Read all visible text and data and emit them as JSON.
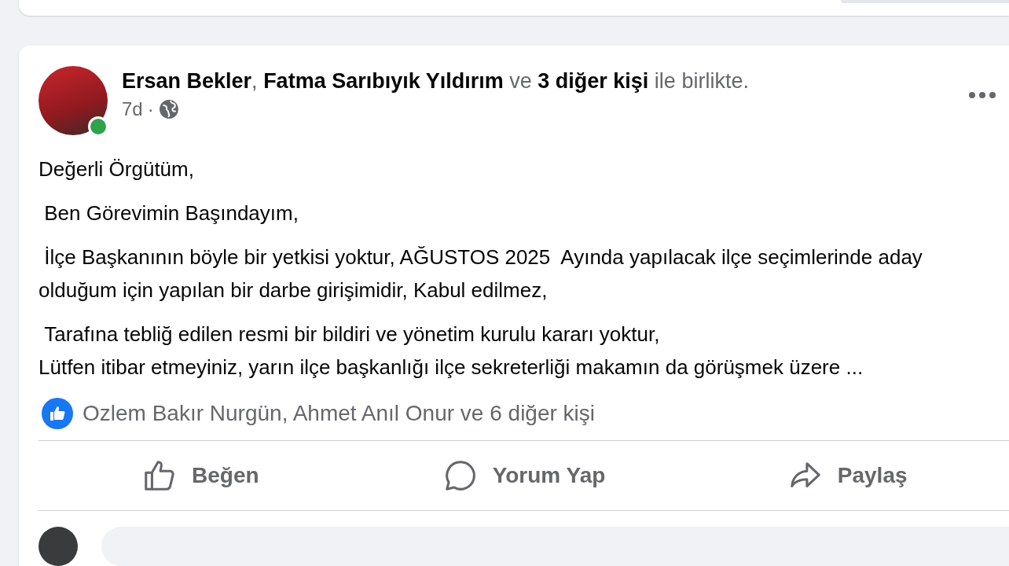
{
  "post": {
    "author": {
      "online": true
    },
    "header": "**Ersan Bekler**, **Fatma Sarıbıyık Yıldırım** ve **3 diğer kişi** ile birlikte.",
    "time": "7d",
    "separator": "·",
    "paragraphs": [
      "Değerli Örgütüm,",
      " Ben Görevimin Başındayım,",
      " İlçe Başkanının böyle bir yetkisi yoktur, AĞUSTOS 2025  Ayında yapılacak ilçe seçimlerinde aday olduğum için yapılan bir darbe girişimidir, Kabul edilmez,",
      " Tarafına tebliğ edilen resmi bir bildiri ve yönetim kurulu kararı yoktur,\nLütfen itibar etmeyiniz, yarın ilçe başkanlığı ilçe sekreterliği makamın da görüşmek üzere ..."
    ],
    "reactions": "Ozlem Bakır Nurgün, Ahmet Anıl Onur ve 6 diğer kişi",
    "actions": [
      {
        "kind": "like",
        "label": "Beğen"
      },
      {
        "kind": "comment",
        "label": "Yorum Yap"
      },
      {
        "kind": "share",
        "label": "Paylaş"
      }
    ]
  }
}
